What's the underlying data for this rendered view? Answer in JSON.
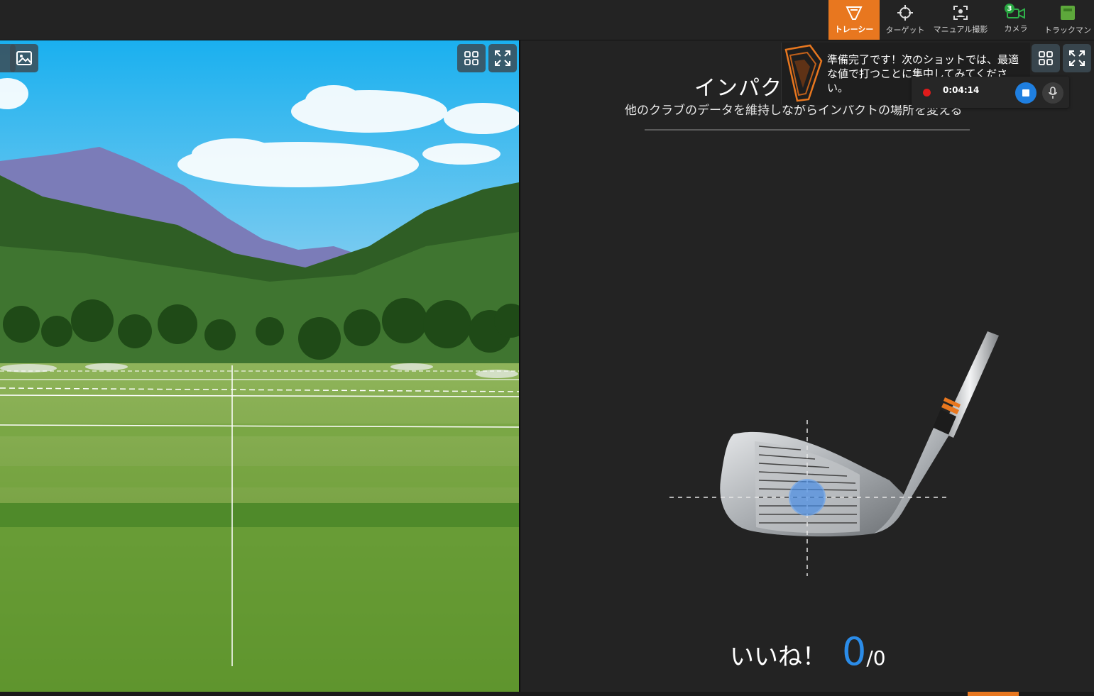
{
  "topnav": {
    "items": [
      {
        "label": "トレーシー",
        "icon": "tracey-icon",
        "active": true
      },
      {
        "label": "ターゲット",
        "icon": "crosshair-icon"
      },
      {
        "label": "マニュアル撮影",
        "icon": "manual-capture-icon"
      },
      {
        "label": "カメラ",
        "icon": "camera-icon",
        "badge": "3"
      },
      {
        "label": "トラックマン",
        "icon": "trackman-icon"
      }
    ]
  },
  "impact": {
    "title": "インパク",
    "subtitle": "他のクラブのデータを維持しながらインパクトの場所を変える"
  },
  "likes": {
    "label": "いいね！",
    "count": "0",
    "total": "/0"
  },
  "tracey": {
    "message": "準備完了です！次のショットでは、最適な値で打つことに集中してみてください。"
  },
  "recording": {
    "time": "0:04:14"
  },
  "colors": {
    "accent": "#e8771f",
    "highlight": "#2b8ce8",
    "panel": "#232323",
    "record": "#e01b1b"
  }
}
